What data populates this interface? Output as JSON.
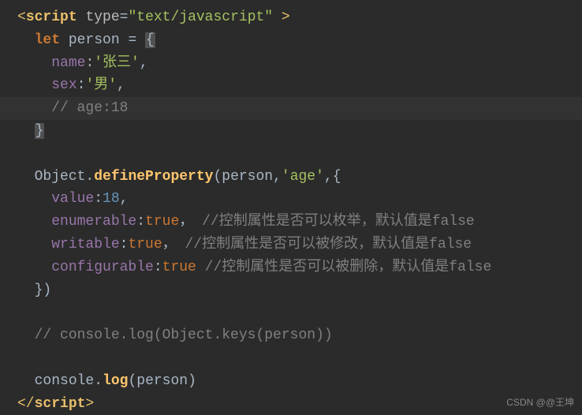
{
  "code": {
    "line1_open": "<",
    "line1_tag": "script",
    "line1_attr": "type",
    "line1_eq": "=",
    "line1_val": "\"text/javascript\"",
    "line1_close": " >",
    "line2_let": "let",
    "line2_person": " person ",
    "line2_eq": "= ",
    "line2_brace": "{",
    "line3_name": "name",
    "line3_colon": ":",
    "line3_val": "'张三'",
    "line3_comma": ",",
    "line4_sex": "sex",
    "line4_colon": ":",
    "line4_val": "'男'",
    "line4_comma": ",",
    "line5_comment": "// age:18",
    "line6_brace": "}",
    "line8_object": "Object",
    "line8_dot": ".",
    "line8_func": "defineProperty",
    "line8_open": "(",
    "line8_person": "person",
    "line8_c1": ",",
    "line8_age": "'age'",
    "line8_c2": ",",
    "line8_brace": "{",
    "line9_value": "value",
    "line9_colon": ":",
    "line9_num": "18",
    "line9_comma": ",",
    "line10_enum": "enumerable",
    "line10_colon": ":",
    "line10_true": "true",
    "line10_comma": "，",
    "line10_comment": "//控制属性是否可以枚举，默认值是false",
    "line11_writable": "writable",
    "line11_colon": ":",
    "line11_true": "true",
    "line11_comma": "，",
    "line11_comment": "//控制属性是否可以被修改，默认值是false",
    "line12_conf": "configurable",
    "line12_colon": ":",
    "line12_true": "true",
    "line12_comment": " //控制属性是否可以被删除，默认值是false",
    "line13_close": "})",
    "line15_comment": "// console.log(Object.keys(person))",
    "line17_console": "console",
    "line17_dot": ".",
    "line17_log": "log",
    "line17_open": "(",
    "line17_person": "person",
    "line17_close": ")",
    "line18_open": "</",
    "line18_tag": "script",
    "line18_close": ">"
  },
  "watermark": "CSDN @@王坤"
}
